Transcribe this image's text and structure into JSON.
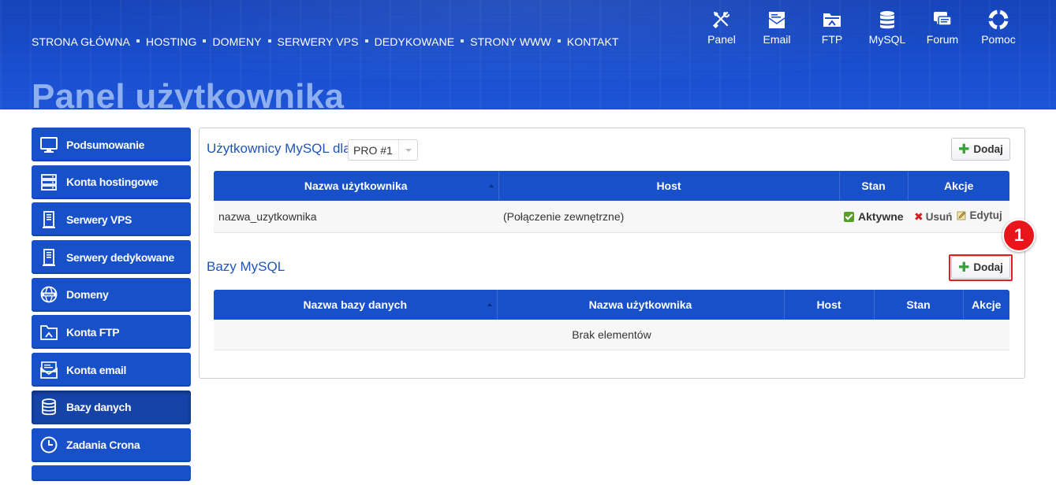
{
  "nav": {
    "links": [
      "STRONA GŁÓWNA",
      "HOSTING",
      "DOMENY",
      "SERWERY VPS",
      "DEDYKOWANE",
      "STRONY WWW",
      "KONTAKT"
    ]
  },
  "quick": [
    {
      "label": "Panel",
      "icon": "tools-icon"
    },
    {
      "label": "Email",
      "icon": "email-icon"
    },
    {
      "label": "FTP",
      "icon": "ftp-folder-icon"
    },
    {
      "label": "MySQL",
      "icon": "database-icon"
    },
    {
      "label": "Forum",
      "icon": "chat-icon"
    },
    {
      "label": "Pomoc",
      "icon": "lifebuoy-icon"
    }
  ],
  "page": {
    "title": "Panel użytkownika"
  },
  "sidebar": {
    "items": [
      {
        "label": "Podsumowanie",
        "icon": "monitor-icon"
      },
      {
        "label": "Konta hostingowe",
        "icon": "server-stack-icon"
      },
      {
        "label": "Serwery VPS",
        "icon": "server-tower-icon"
      },
      {
        "label": "Serwery dedykowane",
        "icon": "server-tower-icon"
      },
      {
        "label": "Domeny",
        "icon": "globe-www-icon"
      },
      {
        "label": "Konta FTP",
        "icon": "ftp-folder-icon"
      },
      {
        "label": "Konta email",
        "icon": "email-icon"
      },
      {
        "label": "Bazy danych",
        "icon": "database-icon",
        "active": true
      },
      {
        "label": "Zadania Crona",
        "icon": "clock-icon"
      }
    ]
  },
  "users_section": {
    "title": "Użytkownicy MySQL dla",
    "select_value": "PRO #1",
    "add_label": "Dodaj",
    "columns": [
      "Nazwa użytkownika",
      "Host",
      "Stan",
      "Akcje"
    ],
    "rows": [
      {
        "name": "nazwa_uzytkownika",
        "host": "(Połączenie zewnętrzne)",
        "status": "Aktywne",
        "delete_label": "Usuń",
        "edit_label": "Edytuj"
      }
    ]
  },
  "db_section": {
    "title": "Bazy MySQL",
    "add_label": "Dodaj",
    "columns": [
      "Nazwa bazy danych",
      "Nazwa użytkownika",
      "Host",
      "Stan",
      "Akcje"
    ],
    "empty_text": "Brak elementów"
  },
  "annotation": {
    "badge": "1"
  },
  "colors": {
    "primary": "#1750c9",
    "accent_title": "#1f55b9",
    "highlight": "#e02020",
    "plus": "#3aa23a"
  }
}
